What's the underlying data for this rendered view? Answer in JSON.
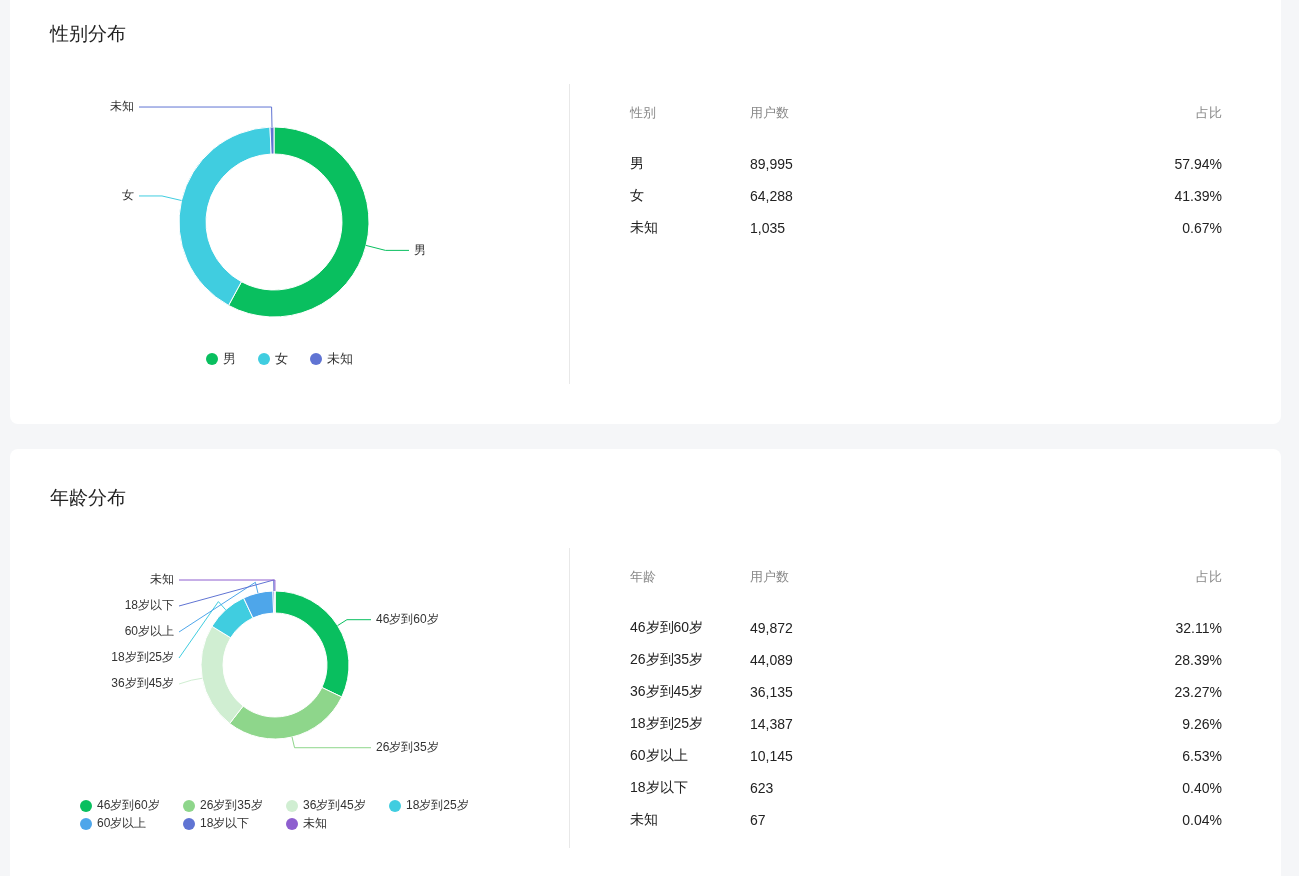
{
  "sections": [
    {
      "title": "性别分布",
      "chart_data": {
        "type": "donut",
        "categories": [
          "男",
          "女",
          "未知"
        ],
        "values": [
          57.94,
          41.39,
          0.67
        ]
      },
      "legend": [
        {
          "label": "男",
          "color": "#09bf5f"
        },
        {
          "label": "女",
          "color": "#40cde0"
        },
        {
          "label": "未知",
          "color": "#6074d3"
        }
      ],
      "table": {
        "columns": [
          "性别",
          "用户数",
          "占比"
        ],
        "rows": [
          [
            "男",
            "89,995",
            "57.94%"
          ],
          [
            "女",
            "64,288",
            "41.39%"
          ],
          [
            "未知",
            "1,035",
            "0.67%"
          ]
        ]
      }
    },
    {
      "title": "年龄分布",
      "chart_data": {
        "type": "donut",
        "categories": [
          "46岁到60岁",
          "26岁到35岁",
          "36岁到45岁",
          "18岁到25岁",
          "60岁以上",
          "18岁以下",
          "未知"
        ],
        "values": [
          32.11,
          28.39,
          23.27,
          9.26,
          6.53,
          0.4,
          0.04
        ]
      },
      "legend": [
        {
          "label": "46岁到60岁",
          "color": "#09bf5f"
        },
        {
          "label": "26岁到35岁",
          "color": "#8ed68b"
        },
        {
          "label": "36岁到45岁",
          "color": "#d0eed2"
        },
        {
          "label": "18岁到25岁",
          "color": "#40cde0"
        },
        {
          "label": "60岁以上",
          "color": "#4ea6ea"
        },
        {
          "label": "18岁以下",
          "color": "#6074d3"
        },
        {
          "label": "未知",
          "color": "#8e5fcf"
        }
      ],
      "table": {
        "columns": [
          "年龄",
          "用户数",
          "占比"
        ],
        "rows": [
          [
            "46岁到60岁",
            "49,872",
            "32.11%"
          ],
          [
            "26岁到35岁",
            "44,089",
            "28.39%"
          ],
          [
            "36岁到45岁",
            "36,135",
            "23.27%"
          ],
          [
            "18岁到25岁",
            "14,387",
            "9.26%"
          ],
          [
            "60岁以上",
            "10,145",
            "6.53%"
          ],
          [
            "18岁以下",
            "623",
            "0.40%"
          ],
          [
            "未知",
            "67",
            "0.04%"
          ]
        ]
      }
    }
  ]
}
